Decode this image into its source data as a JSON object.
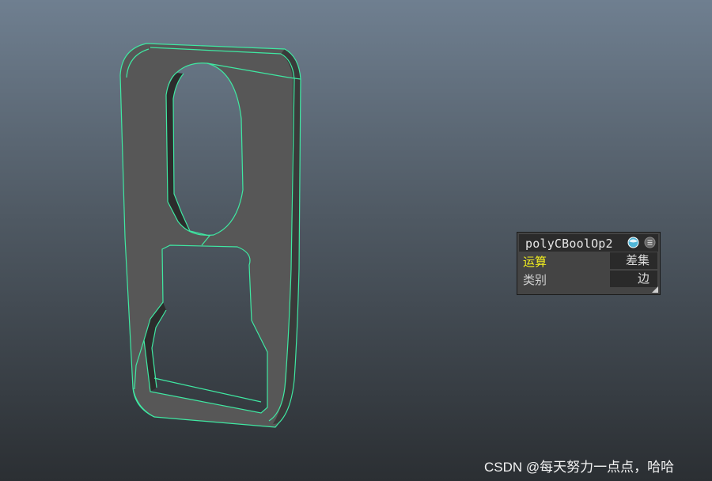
{
  "panel": {
    "node_name": "polyCBoolOp2",
    "attributes": [
      {
        "label": "运算",
        "value": "差集"
      },
      {
        "label": "类别",
        "value": "边"
      }
    ],
    "icons": [
      "shaded-sphere-icon",
      "menu-icon"
    ]
  },
  "watermark": {
    "text": "CSDN @每天努力一点点，哈哈"
  },
  "colors": {
    "wireframe": "#3fe8a2",
    "mesh_face": "#575757",
    "active_attr_label": "#f2ee1f"
  }
}
